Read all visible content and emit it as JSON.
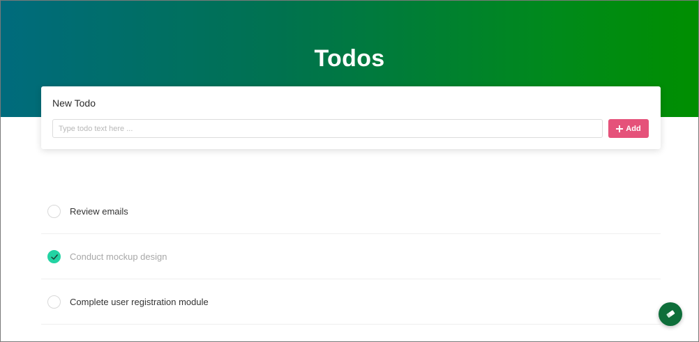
{
  "header": {
    "title": "Todos"
  },
  "new_todo": {
    "title": "New Todo",
    "input_value": "",
    "input_placeholder": "Type todo text here ...",
    "add_label": "Add"
  },
  "todos": [
    {
      "text": "Review emails",
      "done": false
    },
    {
      "text": "Conduct mockup design",
      "done": true
    },
    {
      "text": "Complete user registration module",
      "done": false
    }
  ],
  "colors": {
    "header_gradient_start": "#006b7d",
    "header_gradient_end": "#008e00",
    "add_button": "#e5527a",
    "check_done": "#23d3a3",
    "fab": "#0e6e3a"
  },
  "icons": {
    "add": "plus-icon",
    "check": "check-icon",
    "fab": "eraser-icon"
  }
}
